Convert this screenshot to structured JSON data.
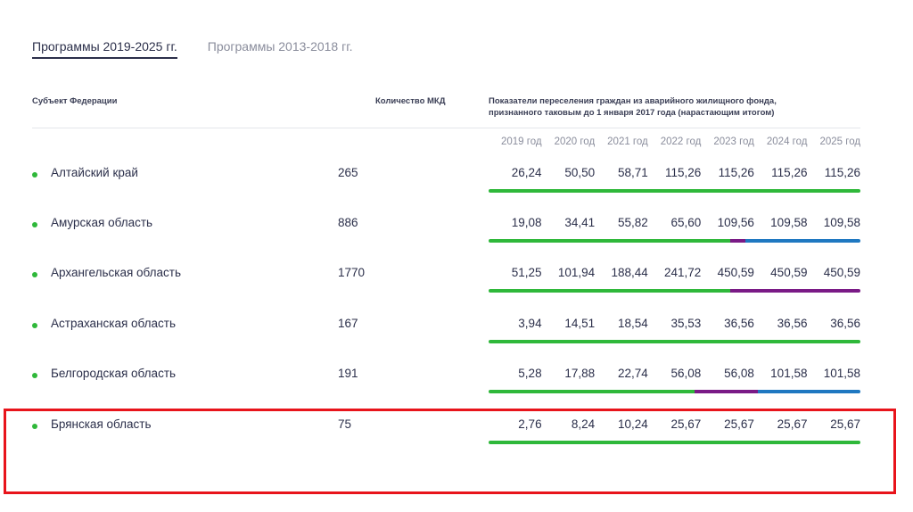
{
  "tabs": [
    {
      "label": "Программы 2019-2025 гг.",
      "active": true
    },
    {
      "label": "Программы 2013-2018 гг.",
      "active": false
    }
  ],
  "headers": {
    "subject": "Субъект Федерации",
    "count": "Количество МКД",
    "indicators": "Показатели переселения граждан из аварийного жилищного фонда, признанного таковым до 1 января 2017 года (нарастающим итогом)"
  },
  "years": [
    "2019 год",
    "2020 год",
    "2021 год",
    "2022 год",
    "2023 год",
    "2024 год",
    "2025 год"
  ],
  "colors": {
    "green": "#2fb83a",
    "purple": "#7a1a86",
    "blue": "#1f78c1",
    "highlight": "#e8141b"
  },
  "rows": [
    {
      "region": "Алтайский край",
      "count": "265",
      "values": [
        "26,24",
        "50,50",
        "58,71",
        "115,26",
        "115,26",
        "115,26",
        "115,26"
      ],
      "bar": [
        {
          "color": "#2fb83a",
          "fraction": 1.0
        }
      ]
    },
    {
      "region": "Амурская область",
      "count": "886",
      "values": [
        "19,08",
        "34,41",
        "55,82",
        "65,60",
        "109,56",
        "109,58",
        "109,58"
      ],
      "bar": [
        {
          "color": "#2fb83a",
          "fraction": 0.65
        },
        {
          "color": "#7a1a86",
          "fraction": 0.04
        },
        {
          "color": "#1f78c1",
          "fraction": 0.31
        }
      ]
    },
    {
      "region": "Архангельская область",
      "count": "1770",
      "values": [
        "51,25",
        "101,94",
        "188,44",
        "241,72",
        "450,59",
        "450,59",
        "450,59"
      ],
      "bar": [
        {
          "color": "#2fb83a",
          "fraction": 0.65
        },
        {
          "color": "#7a1a86",
          "fraction": 0.35
        }
      ]
    },
    {
      "region": "Астраханская область",
      "count": "167",
      "values": [
        "3,94",
        "14,51",
        "18,54",
        "35,53",
        "36,56",
        "36,56",
        "36,56"
      ],
      "bar": [
        {
          "color": "#2fb83a",
          "fraction": 1.0
        }
      ]
    },
    {
      "region": "Белгородская область",
      "count": "191",
      "values": [
        "5,28",
        "17,88",
        "22,74",
        "56,08",
        "56,08",
        "101,58",
        "101,58"
      ],
      "bar": [
        {
          "color": "#2fb83a",
          "fraction": 0.555
        },
        {
          "color": "#7a1a86",
          "fraction": 0.17
        },
        {
          "color": "#1f78c1",
          "fraction": 0.275
        }
      ]
    },
    {
      "region": "Брянская область",
      "count": "75",
      "values": [
        "2,76",
        "8,24",
        "10,24",
        "25,67",
        "25,67",
        "25,67",
        "25,67"
      ],
      "bar": [
        {
          "color": "#2fb83a",
          "fraction": 1.0
        }
      ]
    }
  ]
}
